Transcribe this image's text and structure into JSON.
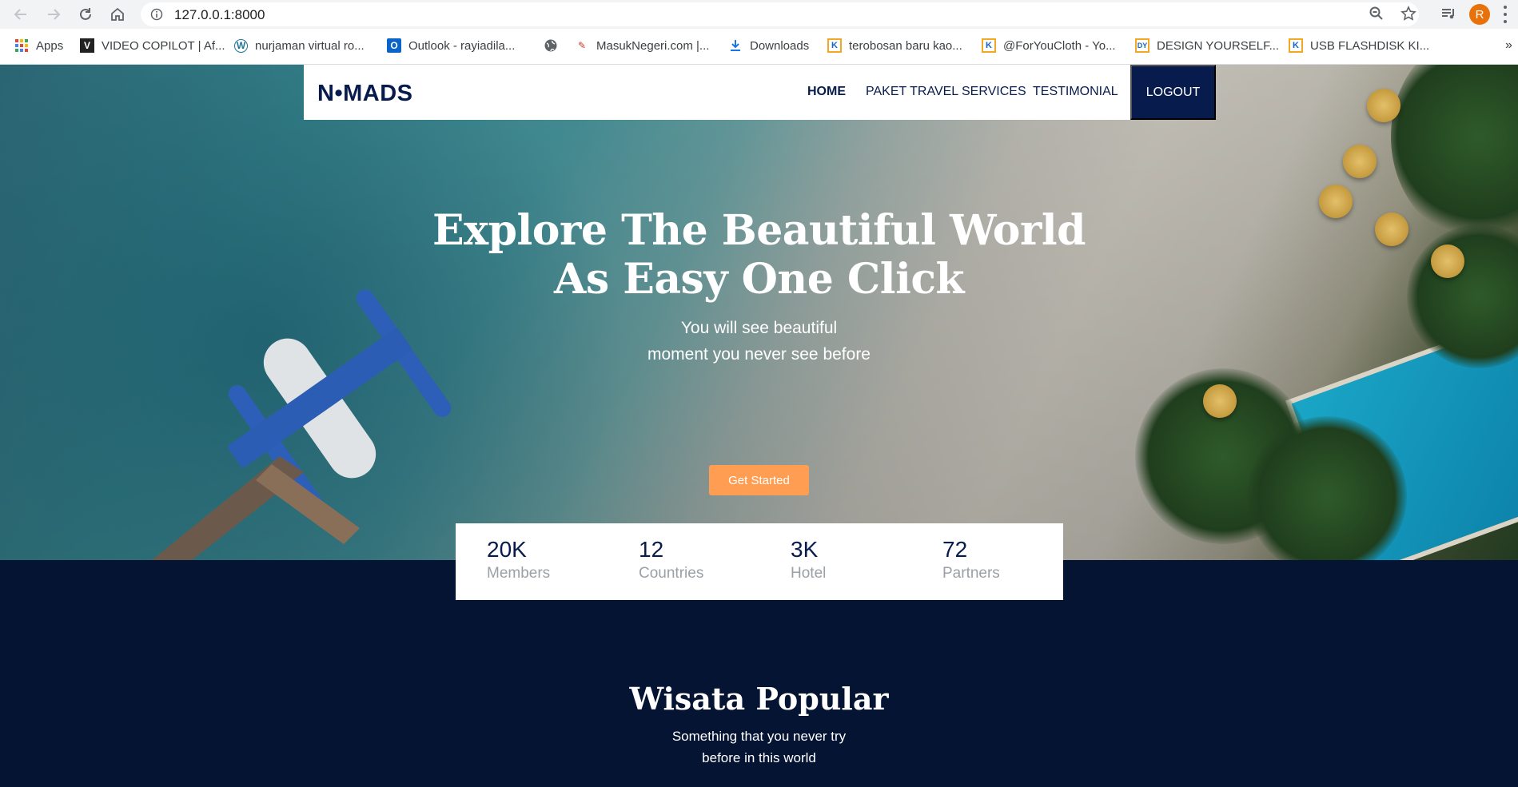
{
  "browser": {
    "url": "127.0.0.1:8000",
    "avatar_letter": "R",
    "bookmarks": [
      {
        "label": "Apps",
        "icon": "apps-grid-icon"
      },
      {
        "label": "VIDEO COPILOT | Af...",
        "icon": "videocopilot-icon"
      },
      {
        "label": "nurjaman virtual ro...",
        "icon": "wordpress-icon"
      },
      {
        "label": "Outlook - rayiadila...",
        "icon": "outlook-icon"
      },
      {
        "label": "",
        "icon": "globe-icon"
      },
      {
        "label": "MasukNegeri.com |...",
        "icon": "masuknegeri-icon"
      },
      {
        "label": "Downloads",
        "icon": "download-icon"
      },
      {
        "label": "terobosan baru kao...",
        "icon": "k-bookmark-icon"
      },
      {
        "label": "@ForYouCloth - Yo...",
        "icon": "k-bookmark-icon"
      },
      {
        "label": "DESIGN YOURSELF...",
        "icon": "design-bookmark-icon"
      },
      {
        "label": "USB FLASHDISK KI...",
        "icon": "k-bookmark-icon"
      }
    ],
    "overflow": "»"
  },
  "navbar": {
    "logo": "N•MADS",
    "links": [
      {
        "label": "HOME",
        "active": true
      },
      {
        "label": "PAKET TRAVEL",
        "active": false
      },
      {
        "label": "SERVICES",
        "active": false
      },
      {
        "label": "TESTIMONIAL",
        "active": false
      }
    ],
    "logout": "LOGOUT"
  },
  "hero": {
    "title_line1": "Explore The Beautiful World",
    "title_line2": "As Easy One Click",
    "subtitle_line1": "You will see beautiful",
    "subtitle_line2": "moment you never see before",
    "cta": "Get Started"
  },
  "stats": [
    {
      "value": "20K",
      "label": "Members"
    },
    {
      "value": "12",
      "label": "Countries"
    },
    {
      "value": "3K",
      "label": "Hotel"
    },
    {
      "value": "72",
      "label": "Partners"
    }
  ],
  "popular": {
    "title": "Wisata Popular",
    "subtitle_line1": "Something that you never try",
    "subtitle_line2": "before in this world"
  },
  "colors": {
    "navy": "#071c4d",
    "accent": "#ff9e53",
    "section_bg": "#061434"
  }
}
